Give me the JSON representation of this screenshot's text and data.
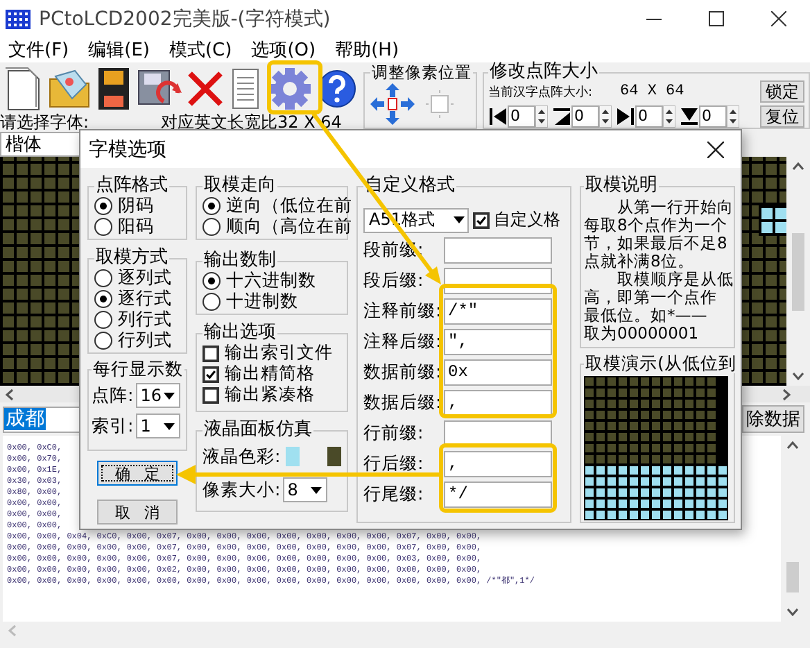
{
  "window": {
    "title": "PCtoLCD2002完美版-(字符模式)"
  },
  "menu": [
    "文件(F)",
    "编辑(E)",
    "模式(C)",
    "选项(O)",
    "帮助(H)"
  ],
  "toolbar": {
    "font_label": "请选择字体:",
    "ratio_label": "对应英文长宽比32 X 64"
  },
  "pixel_position": {
    "title": "调整像素位置"
  },
  "matrix_size": {
    "title": "修改点阵大小",
    "current_label": "当前汉字点阵大小:",
    "current_value": "64 X 64",
    "lock_button": "锁定",
    "reset_button": "复位",
    "spinners": [
      {
        "kind": "left",
        "value": "0"
      },
      {
        "kind": "top",
        "value": "0"
      },
      {
        "kind": "right",
        "value": "0"
      },
      {
        "kind": "bottom",
        "value": "0"
      }
    ]
  },
  "font_select": {
    "value": "楷体"
  },
  "input": {
    "value": "成都",
    "selected": true
  },
  "clear_button": "除数据",
  "output_lines": [
    "0x00, 0xC0,",
    "0x00, 0x70,",
    "0x00, 0x1E,",
    "0x30, 0x03,",
    "0x80, 0x00,",
    "0x00, 0x00,",
    "0x00, 0x00,",
    "0x00, 0x00,",
    "0x00, 0x00, 0x04, 0xC0, 0x00, 0x07, 0x00, 0x00, 0x00, 0x00, 0x00, 0x00, 0x00, 0x07, 0x00, 0x00,",
    "0x00, 0x00, 0x00, 0x00, 0x00, 0x07, 0x00, 0x00, 0x00, 0x00, 0x00, 0x00, 0x00, 0x07, 0x00, 0x00,",
    "0x00, 0x00, 0x00, 0x00, 0x00, 0x07, 0x00, 0x00, 0x00, 0x00, 0x00, 0x00, 0x00, 0x03, 0x00, 0x00,",
    "0x00, 0x00, 0x00, 0x00, 0x00, 0x02, 0x00, 0x00, 0x00, 0x00, 0x00, 0x00, 0x00, 0x00, 0x00, 0x00,",
    "0x00, 0x00, 0x00, 0x00, 0x00, 0x00, 0x00, 0x00, 0x00, 0x00, 0x00, 0x00, 0x00, 0x00, 0x00, 0x00, /*\"都\",1*/"
  ],
  "dialog": {
    "title": "字模选项",
    "dot_format": {
      "title": "点阵格式",
      "options": [
        {
          "label": "阴码",
          "selected": true
        },
        {
          "label": "阳码",
          "selected": false
        }
      ]
    },
    "scan_mode": {
      "title": "取模方式",
      "options": [
        {
          "label": "逐列式",
          "selected": false
        },
        {
          "label": "逐行式",
          "selected": true
        },
        {
          "label": "列行式",
          "selected": false
        },
        {
          "label": "行列式",
          "selected": false
        }
      ]
    },
    "per_line": {
      "title": "每行显示数",
      "dot_label": "点阵:",
      "dot_value": "16",
      "index_label": "索引:",
      "index_value": "1"
    },
    "ok_button": {
      "label": "确   定",
      "focused": true
    },
    "cancel_button": {
      "label": "取   消",
      "focused": false
    },
    "direction": {
      "title": "取模走向",
      "options": [
        {
          "label": "逆向（低位在前",
          "selected": true
        },
        {
          "label": "顺向（高位在前",
          "selected": false
        }
      ]
    },
    "number_base": {
      "title": "输出数制",
      "options": [
        {
          "label": "十六进制数",
          "selected": true
        },
        {
          "label": "十进制数",
          "selected": false
        }
      ]
    },
    "output_options": {
      "title": "输出选项",
      "items": [
        {
          "label": "输出索引文件",
          "checked": false
        },
        {
          "label": "输出精简格",
          "checked": true
        },
        {
          "label": "输出紧凑格",
          "checked": false
        }
      ]
    },
    "lcd_sim": {
      "title": "液晶面板仿真",
      "color_label": "液晶色彩:",
      "colors": [
        {
          "color": "#a0e0f0"
        },
        {
          "color": "#4a4a28"
        }
      ],
      "pixel_label": "像素大小:",
      "pixel_value": "8"
    },
    "custom_format": {
      "title": "自定义格式",
      "preset": "A51格式",
      "enabled_label": "自定义格",
      "enabled": true,
      "fields": [
        {
          "label": "段前缀:"
        },
        {
          "label": "段后缀:"
        },
        {
          "label": "注释前缀:",
          "value": "/*\""
        },
        {
          "label": "注释后缀:",
          "value": "\","
        },
        {
          "label": "数据前缀:",
          "value": "0x"
        },
        {
          "label": "数据后缀:",
          "value": ","
        },
        {
          "label": "行前缀:"
        },
        {
          "label": "行后缀:",
          "value": ","
        },
        {
          "label": "行尾缀:",
          "value": "*/"
        }
      ]
    },
    "help": {
      "title": "取模说明",
      "lines": [
        {
          "text": "从第一行开始向",
          "indent": true
        },
        {
          "text": "每取8个点作为一个",
          "indent": false
        },
        {
          "text": "节，如果最后不足8",
          "indent": false
        },
        {
          "text": "点就补满8位。",
          "indent": false
        },
        {
          "text": "取模顺序是从低",
          "indent": true
        },
        {
          "text": "高，即第一个点作",
          "indent": false
        },
        {
          "text": "最低位。如*——",
          "indent": false
        },
        {
          "text": "取为00000001",
          "indent": false
        }
      ]
    },
    "demo": {
      "title": "取模演示(从低位到"
    }
  }
}
